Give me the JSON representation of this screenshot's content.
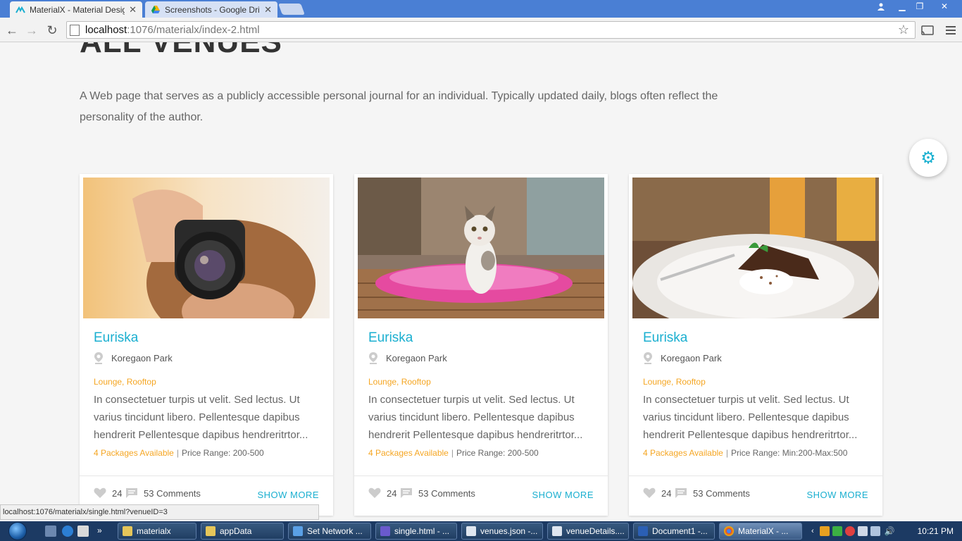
{
  "browser": {
    "tabs": [
      {
        "title": "MaterialX - Material Desig",
        "active": true
      },
      {
        "title": "Screenshots - Google Driv",
        "active": false
      }
    ],
    "url_host": "localhost",
    "url_path": ":1076/materialx/index-2.html"
  },
  "page": {
    "heading": "ALL VENUES",
    "intro": "A Web page that serves as a publicly accessible personal journal for an individual. Typically updated daily, blogs often reflect the personality of the author.",
    "settings_icon": "gear-icon"
  },
  "venues": [
    {
      "name": "Euriska",
      "location": "Koregaon Park",
      "tags": "Lounge, Rooftop",
      "description": "In consectetuer turpis ut velit. Sed lectus. Ut varius tincidunt libero. Pellentesque dapibus hendrerit Pellentesque dapibus hendreritrtor...",
      "packages": "4 Packages Available",
      "price": "Price Range: 200-500",
      "likes": "24",
      "comments": "53 Comments",
      "more": "SHOW MORE"
    },
    {
      "name": "Euriska",
      "location": "Koregaon Park",
      "tags": "Lounge, Rooftop",
      "description": "In consectetuer turpis ut velit. Sed lectus. Ut varius tincidunt libero. Pellentesque dapibus hendrerit Pellentesque dapibus hendreritrtor...",
      "packages": "4 Packages Available",
      "price": "Price Range: 200-500",
      "likes": "24",
      "comments": "53 Comments",
      "more": "SHOW MORE"
    },
    {
      "name": "Euriska",
      "location": "Koregaon Park",
      "tags": "Lounge, Rooftop",
      "description": "In consectetuer turpis ut velit. Sed lectus. Ut varius tincidunt libero. Pellentesque dapibus hendrerit Pellentesque dapibus hendreritrtor...",
      "packages": "4 Packages Available",
      "price": "Price Range: Min:200-Max:500",
      "likes": "24",
      "comments": "53 Comments",
      "more": "SHOW MORE"
    }
  ],
  "status_url": "localhost:1076/materialx/single.html?venueID=3",
  "taskbar": {
    "items": [
      "materialx",
      "appData",
      "Set Network ...",
      "single.html - ...",
      "venues.json -...",
      "venueDetails....",
      "Document1 -...",
      "MaterialX - ..."
    ],
    "clock": "10:21 PM"
  },
  "colors": {
    "accent": "#1aafd0",
    "orange": "#f5a623",
    "tabbar": "#4a7fd4",
    "taskbar": "#1c3a63"
  }
}
